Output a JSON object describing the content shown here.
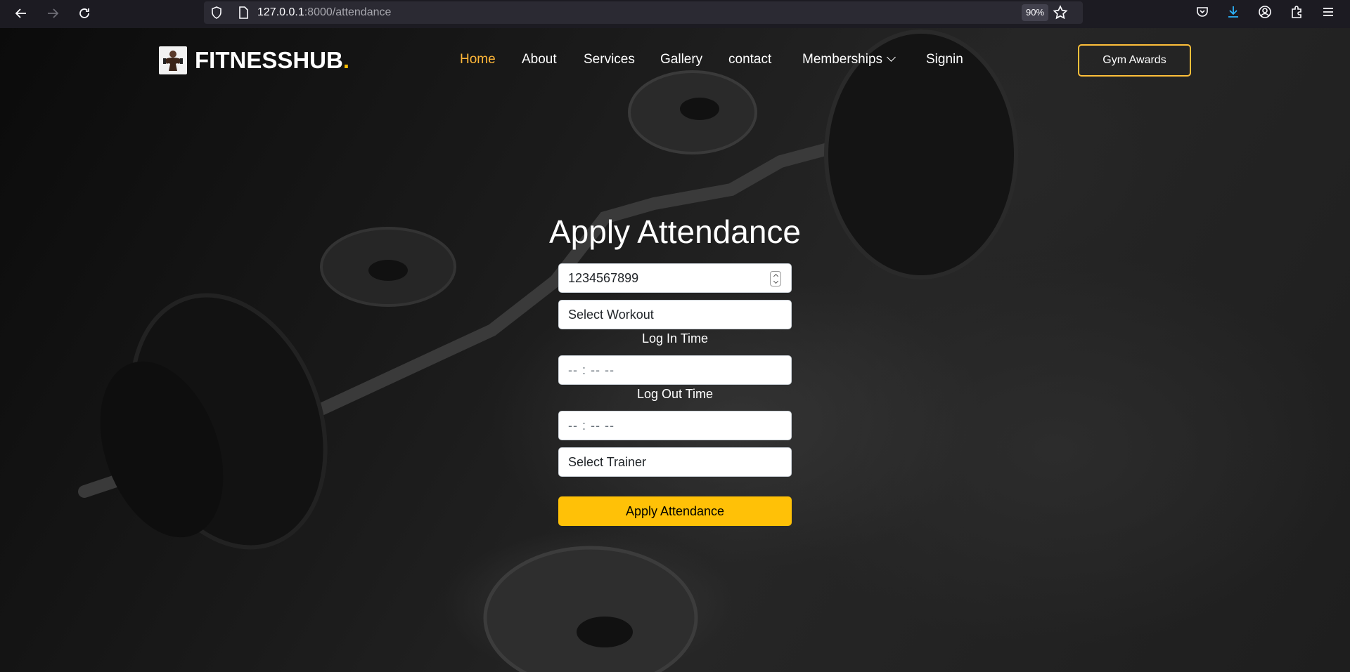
{
  "browser": {
    "url_host": "127.0.0.1",
    "url_path": ":8000/attendance",
    "zoom": "90%"
  },
  "site": {
    "logo_text": "FITNESSHUB",
    "logo_dot": ".",
    "nav": [
      {
        "label": "Home",
        "active": true
      },
      {
        "label": "About"
      },
      {
        "label": "Services"
      },
      {
        "label": "Gallery"
      },
      {
        "label": "contact"
      },
      {
        "label": "Memberships"
      },
      {
        "label": "Signin"
      }
    ],
    "awards_button": "Gym Awards",
    "accent_color": "#ffc107"
  },
  "form": {
    "title": "Apply Attendance",
    "phone_value": "1234567899",
    "workout_select": "Select Workout",
    "login_label": "Log In Time",
    "login_placeholder": "-- : --  --",
    "logout_label": "Log Out Time",
    "logout_placeholder": "-- : --  --",
    "trainer_select": "Select Trainer",
    "submit_label": "Apply Attendance"
  }
}
